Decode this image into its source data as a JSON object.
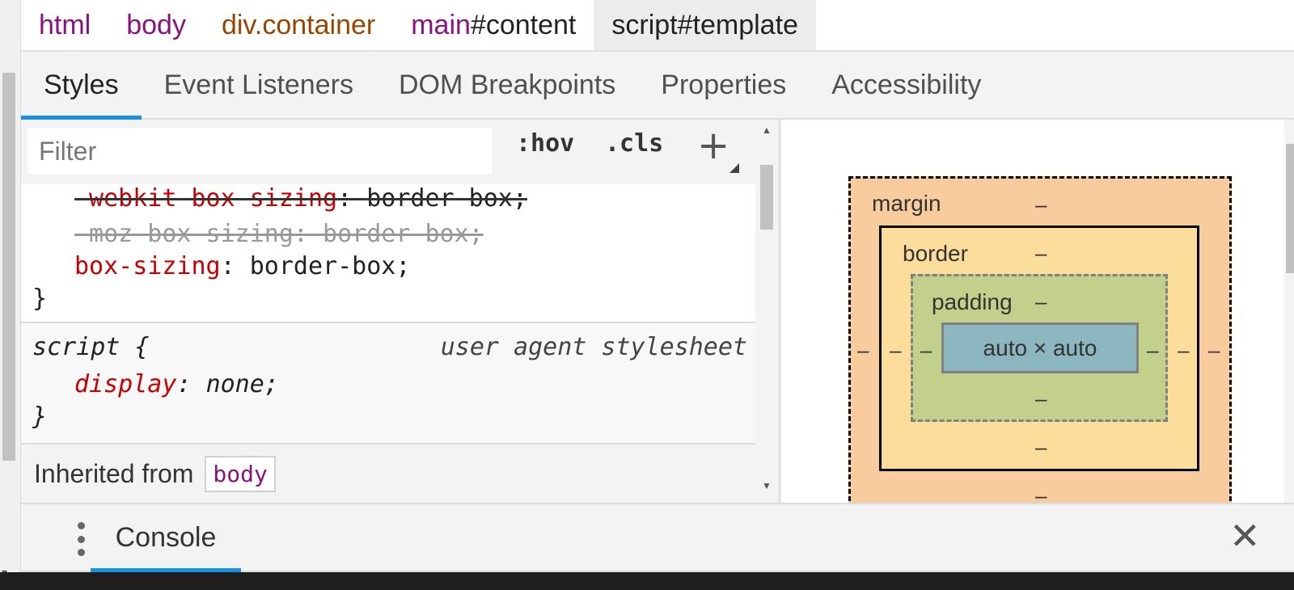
{
  "breadcrumb": [
    {
      "label": "html",
      "type": "tag"
    },
    {
      "label": "body",
      "type": "tag"
    },
    {
      "label": "div.container",
      "type": "class"
    },
    {
      "tag": "main",
      "id": "#content",
      "type": "id"
    },
    {
      "label": "script#template",
      "type": "selected"
    }
  ],
  "tabs": [
    "Styles",
    "Event Listeners",
    "DOM Breakpoints",
    "Properties",
    "Accessibility"
  ],
  "active_tab": "Styles",
  "filter": {
    "placeholder": "Filter",
    "hov": ":hov",
    "cls": ".cls",
    "plus": "+"
  },
  "rules": {
    "first": {
      "decl1": {
        "prop": "-webkit-box-sizing",
        "value": "border-box;"
      },
      "decl2": "-moz-box-sizing: border-box;",
      "decl3": {
        "prop": "box-sizing",
        "value": "border-box;"
      },
      "close": "}"
    },
    "second": {
      "selector": "script {",
      "source": "user agent stylesheet",
      "decl": {
        "prop": "display",
        "value": "none;"
      },
      "close": "}"
    }
  },
  "inherited": {
    "label": "Inherited from",
    "link": "body"
  },
  "box_model": {
    "margin_label": "margin",
    "border_label": "border",
    "padding_label": "padding",
    "content": "auto × auto",
    "dash": "–"
  },
  "drawer": {
    "console_tab": "Console",
    "close": "✕"
  },
  "colors": {
    "accent": "#1a8fe3",
    "tag": "#881280",
    "property": "#c80000"
  }
}
